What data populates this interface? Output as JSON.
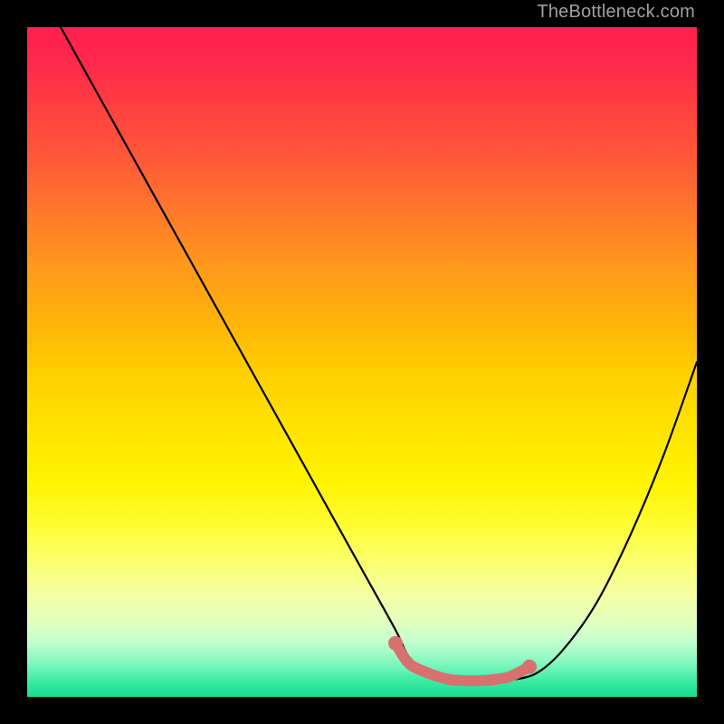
{
  "watermark": "TheBottleneck.com",
  "chart_data": {
    "type": "line",
    "title": "",
    "xlabel": "",
    "ylabel": "",
    "xlim": [
      0,
      100
    ],
    "ylim": [
      0,
      100
    ],
    "series": [
      {
        "name": "curve",
        "x": [
          5,
          10,
          15,
          20,
          25,
          30,
          35,
          40,
          45,
          50,
          55,
          57,
          60,
          63,
          66,
          69,
          72,
          76,
          80,
          85,
          90,
          95,
          100
        ],
        "values": [
          100,
          91,
          82,
          73,
          64,
          55,
          46,
          37,
          28,
          19,
          10,
          6,
          3.5,
          2.5,
          2.2,
          2.2,
          2.5,
          3.5,
          7,
          14,
          24,
          36,
          50
        ]
      },
      {
        "name": "highlight",
        "x": [
          55,
          57,
          60,
          63,
          66,
          69,
          72,
          75
        ],
        "values": [
          8,
          5,
          3.5,
          2.6,
          2.4,
          2.5,
          3,
          4.5
        ]
      }
    ],
    "gradient_stops": [
      {
        "pos": 0,
        "color": "#ff1f4f"
      },
      {
        "pos": 50,
        "color": "#ffd000"
      },
      {
        "pos": 85,
        "color": "#fbff70"
      },
      {
        "pos": 100,
        "color": "#14e08c"
      }
    ]
  }
}
